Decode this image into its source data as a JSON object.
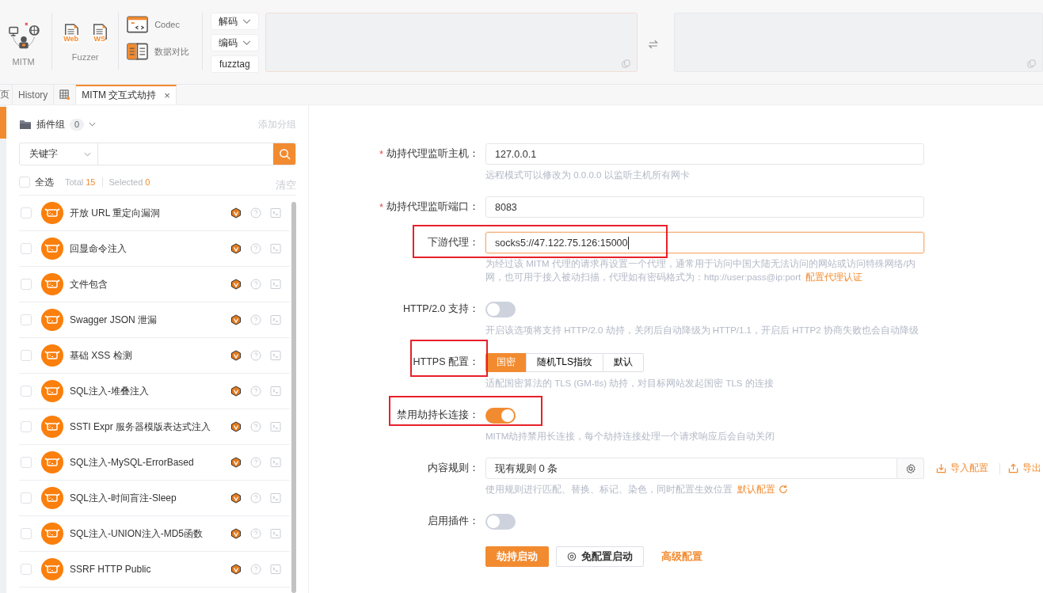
{
  "toolbar": {
    "mitm": {
      "label": "MITM"
    },
    "fuzzer": {
      "label": "Fuzzer",
      "items": [
        "Web",
        "WS"
      ]
    },
    "tools": [
      {
        "kind": "codec",
        "label": "Codec"
      },
      {
        "kind": "compare",
        "label": "数据对比"
      }
    ],
    "codec_buttons": [
      {
        "label": "解码",
        "dropdown": true
      },
      {
        "label": "编码",
        "dropdown": true
      },
      {
        "label": "fuzztag"
      }
    ]
  },
  "tabs": [
    {
      "kind": "text",
      "label": "页",
      "selected": false
    },
    {
      "kind": "text",
      "label": "History",
      "selected": false
    },
    {
      "kind": "icon",
      "selected": false
    },
    {
      "kind": "text",
      "label": "MITM 交互式劫持",
      "selected": true,
      "closable": true,
      "close": "×"
    }
  ],
  "plugins": {
    "group_label": "插件组",
    "group_count": "0",
    "add_group": "添加分组",
    "search_select": "关键字",
    "select_all": {
      "label": "全选",
      "checked": false
    },
    "total_label": "Total",
    "total": "15",
    "selected_label": "Selected",
    "selected": "0",
    "clear": "清空",
    "items": [
      {
        "name": "开放 URL 重定向漏洞",
        "checked": false
      },
      {
        "name": "回显命令注入",
        "checked": false
      },
      {
        "name": "文件包含",
        "checked": false
      },
      {
        "name": "Swagger JSON 泄漏",
        "checked": false
      },
      {
        "name": "基础 XSS 检测",
        "checked": false
      },
      {
        "name": "SQL注入-堆叠注入",
        "checked": false
      },
      {
        "name": "SSTI Expr 服务器模版表达式注入",
        "checked": false
      },
      {
        "name": "SQL注入-MySQL-ErrorBased",
        "checked": false
      },
      {
        "name": "SQL注入-时间盲注-Sleep",
        "checked": false
      },
      {
        "name": "SQL注入-UNION注入-MD5函数",
        "checked": false
      },
      {
        "name": "SSRF HTTP Public",
        "checked": false
      }
    ]
  },
  "form": {
    "fields": [
      {
        "kind": "input",
        "label": "劫持代理监听主机：",
        "required_mark": "*",
        "value": "127.0.0.1",
        "focused": false,
        "hint": "远程模式可以修改为 0.0.0.0 以监听主机所有网卡"
      },
      {
        "kind": "input",
        "label": "劫持代理监听端口：",
        "required_mark": "*",
        "value": "8083",
        "focused": false
      },
      {
        "kind": "input",
        "label": "下游代理：",
        "value": "socks5://47.122.75.126:15000",
        "focused": true,
        "highlighted": true,
        "hint": "为经过该 MITM 代理的请求再设置一个代理，通常用于访问中国大陆无法访问的网站或访问特殊网络/内网，也可用于接入被动扫描，代理如有密码格式为：http://user:pass@ip:port",
        "hint_link": "配置代理认证"
      },
      {
        "kind": "switch",
        "label": "HTTP/2.0 支持：",
        "on": false,
        "hint": "开启该选项将支持 HTTP/2.0 劫持，关闭后自动降级为 HTTP/1.1，开启后 HTTP2 协商失败也会自动降级"
      },
      {
        "kind": "segmented",
        "label": "HTTPS 配置：",
        "highlighted": true,
        "options": [
          {
            "label": "国密",
            "selected": true
          },
          {
            "label": "随机TLS指纹",
            "selected": false
          },
          {
            "label": "默认",
            "selected": false
          }
        ],
        "hint": "适配国密算法的 TLS (GM-tls) 劫持，对目标网站发起国密 TLS 的连接"
      },
      {
        "kind": "switch",
        "label": "禁用劫持长连接：",
        "on": true,
        "highlighted": true,
        "hint": "MITM劫持禁用长连接，每个劫持连接处理一个请求响应后会自动关闭"
      },
      {
        "kind": "rules",
        "label": "内容规则：",
        "value": "现有规则 0 条",
        "actions": [
          "导入配置",
          "导出"
        ],
        "hint": "使用规则进行匹配、替换、标记、染色，同时配置生效位置",
        "hint_link": "默认配置"
      },
      {
        "kind": "switch",
        "label": "启用插件：",
        "on": false
      }
    ],
    "buttons": [
      {
        "kind": "primary",
        "label": "劫持启动"
      },
      {
        "kind": "default",
        "label": "免配置启动"
      },
      {
        "kind": "link",
        "label": "高级配置"
      }
    ]
  }
}
